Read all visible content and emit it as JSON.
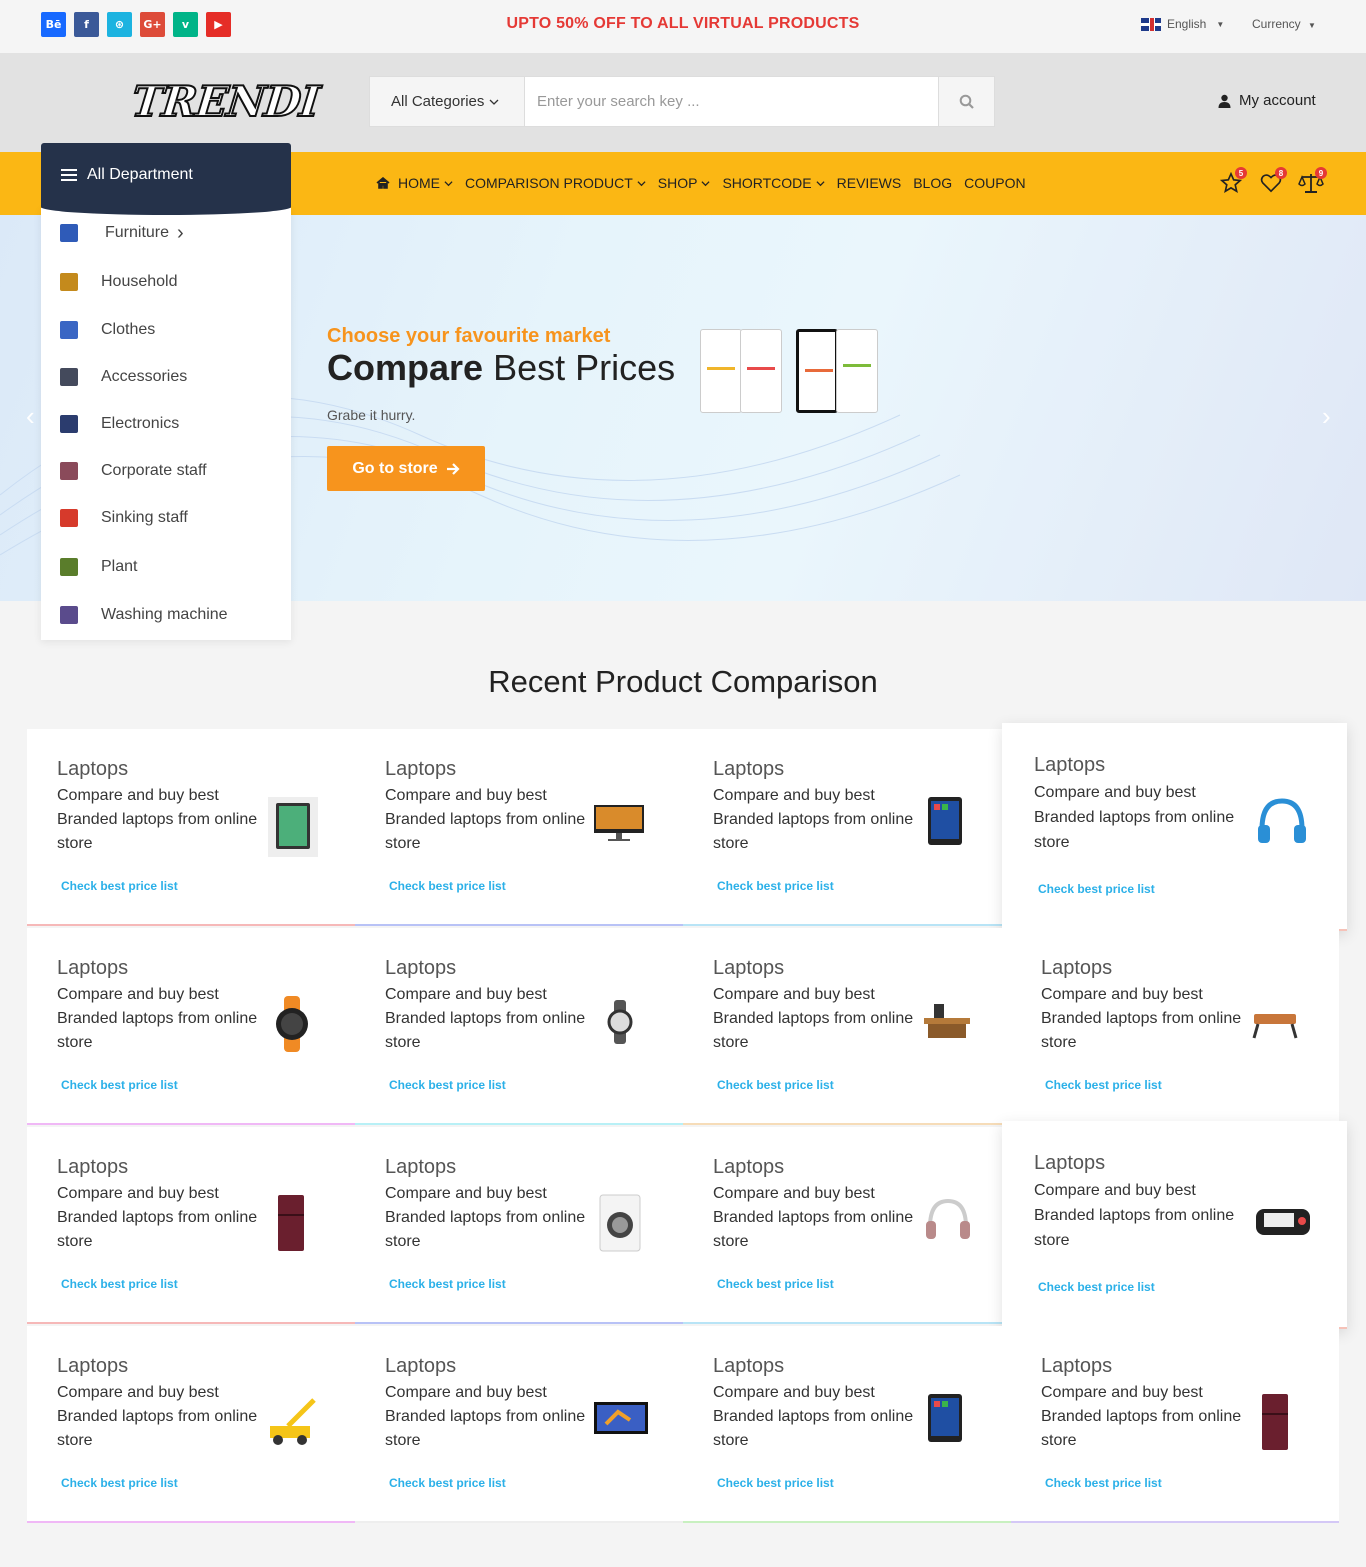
{
  "topbar": {
    "socials": [
      {
        "icon": "behance-icon",
        "glyph": "Bē",
        "color": "#1769ff"
      },
      {
        "icon": "facebook-icon",
        "glyph": "f",
        "color": "#3b5998"
      },
      {
        "icon": "dribbble-icon",
        "glyph": "⊛",
        "color": "#1cb3e0"
      },
      {
        "icon": "google-plus-icon",
        "glyph": "G+",
        "color": "#dd4b39"
      },
      {
        "icon": "vine-icon",
        "glyph": "v",
        "color": "#00b488"
      },
      {
        "icon": "youtube-icon",
        "glyph": "▶",
        "color": "#e52d27"
      }
    ],
    "promo": "UPTO 50% OFF TO ALL VIRTUAL PRODUCTS",
    "language": "English",
    "currency": "Currency"
  },
  "header": {
    "logo": "TRENDI",
    "search_category": "All Categories",
    "search_placeholder": "Enter your search key ...",
    "account": "My account"
  },
  "nav": {
    "department": "All Department",
    "items": [
      "HOME",
      "COMPARISON PRODUCT",
      "SHOP",
      "SHORTCODE",
      "REVIEWS",
      "BLOG",
      "COUPON"
    ],
    "badges": {
      "favorites": "5",
      "wishlist": "8",
      "compare": "9"
    }
  },
  "departments": [
    {
      "label": "Furniture",
      "icon": "chair-icon",
      "color": "#2f5bb8"
    },
    {
      "label": "Household",
      "icon": "cuckoo-clock-icon",
      "color": "#c48a1c"
    },
    {
      "label": "Clothes",
      "icon": "clothes-icon",
      "color": "#3a66c4"
    },
    {
      "label": "Accessories",
      "icon": "wallet-icon",
      "color": "#444a5c"
    },
    {
      "label": "Electronics",
      "icon": "tv-icon",
      "color": "#2b3c6e"
    },
    {
      "label": "Corporate staff",
      "icon": "briefcase-icon",
      "color": "#8a4a5a"
    },
    {
      "label": "Sinking staff",
      "icon": "sink-icon",
      "color": "#d63a2b"
    },
    {
      "label": "Plant",
      "icon": "plant-icon",
      "color": "#5a7d2b"
    },
    {
      "label": "Washing machine",
      "icon": "washing-machine-icon",
      "color": "#5a4b8c"
    }
  ],
  "hero": {
    "pre_title": "Choose your favourite market",
    "title_bold": "Compare",
    "title_rest": "Best Prices",
    "subtitle": "Grabe it hurry.",
    "button": "Go to store"
  },
  "section_title": "Recent Product Comparison",
  "cards": [
    {
      "category": "Laptops",
      "description": "Compare and buy best Branded laptops from online store",
      "link": "Check best price list",
      "thumb": "tablet-icon",
      "accent": "#f6b8b8"
    },
    {
      "category": "Laptops",
      "description": "Compare and buy best Branded laptops from online store",
      "link": "Check best price list",
      "thumb": "monitor-icon",
      "accent": "#b8c2f6"
    },
    {
      "category": "Laptops",
      "description": "Compare and buy best Branded laptops from online store",
      "link": "Check best price list",
      "thumb": "smartphone-icon",
      "accent": "#b8e4f6"
    },
    {
      "category": "Laptops",
      "description": "Compare and buy best Branded laptops from online store",
      "link": "Check best price list",
      "thumb": "headphones-icon",
      "accent": "#f6c2b8"
    },
    {
      "category": "Laptops",
      "description": "Compare and buy best Branded laptops from online store",
      "link": "Check best price list",
      "thumb": "sport-watch-icon",
      "accent": "#f0b8f6"
    },
    {
      "category": "Laptops",
      "description": "Compare and buy best Branded laptops from online store",
      "link": "Check best price list",
      "thumb": "wristwatch-icon",
      "accent": "#b8f0f6"
    },
    {
      "category": "Laptops",
      "description": "Compare and buy best Branded laptops from online store",
      "link": "Check best price list",
      "thumb": "desk-icon",
      "accent": "#f6dcb8"
    },
    {
      "category": "Laptops",
      "description": "Compare and buy best Branded laptops from online store",
      "link": "Check best price list",
      "thumb": "laptop-table-icon",
      "accent": "#eeeeee"
    },
    {
      "category": "Laptops",
      "description": "Compare and buy best Branded laptops from online store",
      "link": "Check best price list",
      "thumb": "refrigerator-icon",
      "accent": "#f6b8b8"
    },
    {
      "category": "Laptops",
      "description": "Compare and buy best Branded laptops from online store",
      "link": "Check best price list",
      "thumb": "washing-machine-icon",
      "accent": "#b8c2f6"
    },
    {
      "category": "Laptops",
      "description": "Compare and buy best Branded laptops from online store",
      "link": "Check best price list",
      "thumb": "headset-icon",
      "accent": "#b8e4f6"
    },
    {
      "category": "Laptops",
      "description": "Compare and buy best Branded laptops from online store",
      "link": "Check best price list",
      "thumb": "blood-pressure-monitor-icon",
      "accent": "#f6c2b8"
    },
    {
      "category": "Laptops",
      "description": "Compare and buy best Branded laptops from online store",
      "link": "Check best price list",
      "thumb": "crane-toy-icon",
      "accent": "#f0b8f6"
    },
    {
      "category": "Laptops",
      "description": "Compare and buy best Branded laptops from online store",
      "link": "Check best price list",
      "thumb": "television-icon",
      "accent": "#eeeeee"
    },
    {
      "category": "Laptops",
      "description": "Compare and buy best Branded laptops from online store",
      "link": "Check best price list",
      "thumb": "smartphone-icon",
      "accent": "#c8f0c0"
    },
    {
      "category": "Laptops",
      "description": "Compare and buy best Branded laptops from online store",
      "link": "Check best price list",
      "thumb": "refrigerator-icon",
      "accent": "#d4c8f6"
    }
  ]
}
